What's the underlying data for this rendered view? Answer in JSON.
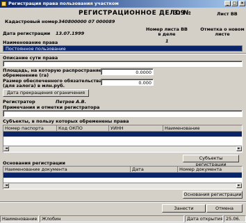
{
  "window": {
    "title": "Регистрация права пользования участком",
    "minimize": "_",
    "maximize": "□",
    "close": "×"
  },
  "header": {
    "case_title": "РЕГИСТРАЦИОННОЕ ДЕЛО №",
    "case_number": "3.9",
    "sheet_label": "Лист ВВ",
    "cadastral_label": "Кадастровый номер",
    "cadastral_value": "340800000 07 000089"
  },
  "registration": {
    "date_label": "Дата регистрации",
    "date_value": "13.07.1999",
    "sheet_no_label": "Номер листа ВВ в деле",
    "sheet_no_value": "1",
    "note_mark_label": "Отметка о новом листе"
  },
  "right_name": {
    "label": "Наименование права",
    "selected": "Постоянное пользование"
  },
  "description": {
    "label": "Описание сути права",
    "value": ""
  },
  "area": {
    "label_line1": "Площадь, на которую распространяется",
    "label_line2": "обременение (га)",
    "value": "0.0000"
  },
  "obligation": {
    "label_line1": "Размер обеспеченного обязательства",
    "label_line2": "(для залога) в млн.руб.",
    "value": "0.000"
  },
  "termination_button": "Дата прекращения ограничения",
  "registrar": {
    "label": "Регистратор",
    "value": "Петров А.В."
  },
  "notes_label": "Примечания и отметки регистратора",
  "subjects": {
    "label": "Субъекты, в пользу которых обременены права",
    "columns": [
      "Номер паспорта",
      "Код ОКПО",
      "УИНН",
      "Наименование"
    ],
    "button": "Субъекты регистрации"
  },
  "grounds": {
    "label": "Основания регистрации",
    "columns": [
      "Наименование документа",
      "Дата",
      "Номер документа"
    ],
    "button": "Основания регистрации"
  },
  "actions": {
    "save": "Занести",
    "cancel": "Отмена"
  },
  "statusbar": {
    "name_label": "Наименование",
    "name_value": "Жлобин",
    "open_date_label": "Дата открытия",
    "open_date_value": "25.06."
  }
}
